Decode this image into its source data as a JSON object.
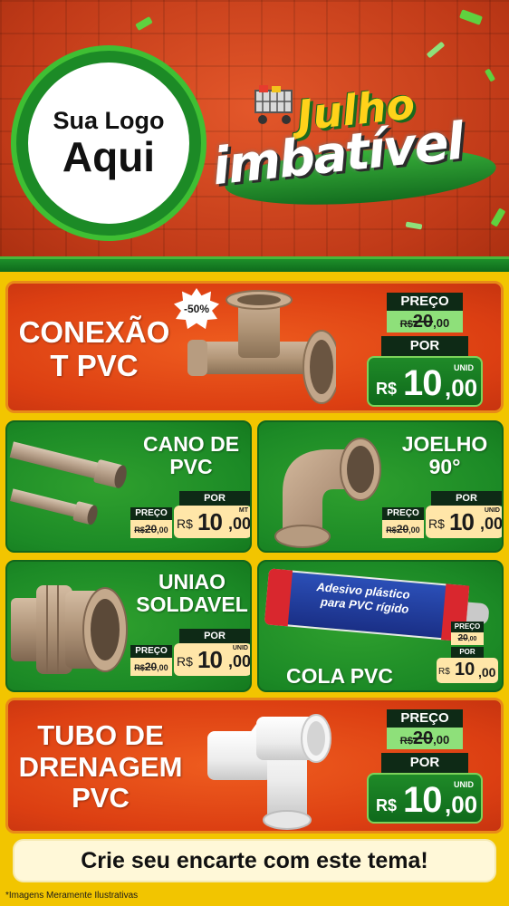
{
  "header": {
    "logo_line1": "Sua Logo",
    "logo_line2": "Aqui",
    "title_line1": "Julho",
    "title_line2": "imbatível"
  },
  "colors": {
    "header_red": "#c8401c",
    "card_red": "#dc3f12",
    "card_green": "#1c8a26",
    "background_yellow": "#f2c500",
    "price_pale_green": "#8ee07a",
    "price_cream": "#ffe6a8"
  },
  "products": {
    "conexao": {
      "name_line1": "CONEXÃO",
      "name_line2": "T PVC",
      "badge": "-50%",
      "preco_label": "PREÇO",
      "old_currency": "R$",
      "old_int": "20",
      "old_cents": ",00",
      "por_label": "POR",
      "currency": "R$",
      "price_int": "10",
      "price_cents": ",00",
      "unit": "UNID",
      "icon": "pvc-tee-fitting-icon"
    },
    "cano": {
      "name_line1": "CANO DE",
      "name_line2": "PVC",
      "preco_label": "PREÇO",
      "old_currency": "R$",
      "old_int": "20",
      "old_cents": ",00",
      "por_label": "POR",
      "currency": "R$",
      "price_int": "10",
      "price_cents": ",00",
      "unit": "MT",
      "icon": "pvc-pipe-icon"
    },
    "joelho": {
      "name_line1": "JOELHO",
      "name_line2": "90°",
      "preco_label": "PREÇO",
      "old_currency": "R$",
      "old_int": "20",
      "old_cents": ",00",
      "por_label": "POR",
      "currency": "R$",
      "price_int": "10",
      "price_cents": ",00",
      "unit": "UNID",
      "icon": "pvc-elbow-icon"
    },
    "uniao": {
      "name_line1": "UNIAO",
      "name_line2": "SOLDAVEL",
      "preco_label": "PREÇO",
      "old_currency": "R$",
      "old_int": "20",
      "old_cents": ",00",
      "por_label": "POR",
      "currency": "R$",
      "price_int": "10",
      "price_cents": ",00",
      "unit": "UNID",
      "icon": "pvc-union-icon"
    },
    "cola": {
      "name": "COLA PVC",
      "tube_line1": "Adesivo plástico",
      "tube_line2": "para PVC rígido",
      "preco_label": "PREÇO",
      "old_int": "20",
      "old_cents": ",00",
      "por_label": "POR",
      "currency": "R$",
      "price_int": "10",
      "price_cents": ",00",
      "icon": "glue-tube-icon"
    },
    "tubo": {
      "name_line1": "TUBO DE",
      "name_line2": "DRENAGEM",
      "name_line3": "PVC",
      "preco_label": "PREÇO",
      "old_currency": "R$",
      "old_int": "20",
      "old_cents": ",00",
      "por_label": "POR",
      "currency": "R$",
      "price_int": "10",
      "price_cents": ",00",
      "unit": "UNID",
      "icon": "white-drain-tee-icon"
    }
  },
  "footer": {
    "banner": "Crie seu encarte com este tema!",
    "disclaimer": "*Imagens Meramente Ilustrativas"
  }
}
